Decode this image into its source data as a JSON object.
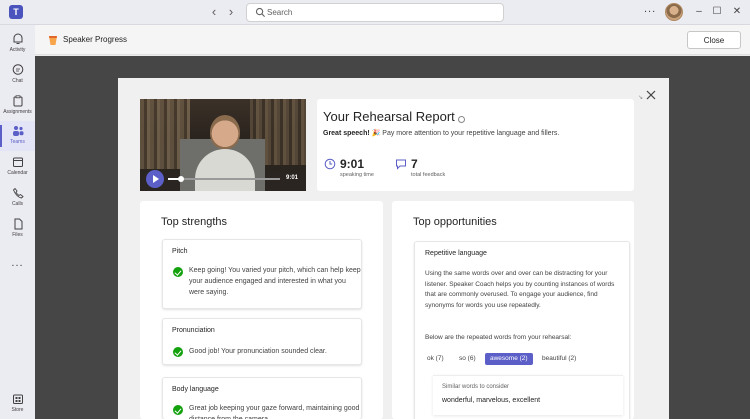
{
  "titlebar": {
    "app_logo": "T",
    "back_icon": "chevron-left",
    "forward_icon": "chevron-right",
    "search_placeholder": "Search",
    "more": "...",
    "minimize": "–",
    "maximize": "☐",
    "close": "✕"
  },
  "rail": {
    "items": [
      {
        "label": "Activity",
        "icon": "bell-icon"
      },
      {
        "label": "Chat",
        "icon": "chat-icon"
      },
      {
        "label": "Assignments",
        "icon": "assignments-icon"
      },
      {
        "label": "Teams",
        "icon": "teams-icon",
        "active": true
      },
      {
        "label": "Calendar",
        "icon": "calendar-icon"
      },
      {
        "label": "Calls",
        "icon": "phone-icon"
      },
      {
        "label": "Files",
        "icon": "file-icon"
      }
    ],
    "more": "...",
    "store_label": "Store"
  },
  "appbar": {
    "title": "Speaker Progress",
    "close_label": "Close"
  },
  "video": {
    "duration": "9:01",
    "progress": 0.12
  },
  "report": {
    "title": "Your Rehearsal Report",
    "sub_bold": "Great speech! 🎉",
    "sub_rest": " Pay more attention to your repetitive language and fillers.",
    "speaking_time_value": "9:01",
    "speaking_time_label": "speaking time",
    "feedback_value": "7",
    "feedback_label": "total feedback"
  },
  "strengths": {
    "title": "Top strengths",
    "cards": [
      {
        "head": "Pitch",
        "text": "Keep going! You varied your pitch, which can help keep your audience engaged and interested in what you were saying."
      },
      {
        "head": "Pronunciation",
        "text": "Good job! Your pronunciation sounded clear."
      },
      {
        "head": "Body language",
        "text": "Great job keeping your gaze forward, maintaining good distance from the camera"
      }
    ]
  },
  "opportunities": {
    "title": "Top opportunities",
    "head": "Repetitive language",
    "paragraph": "Using the same words over and over can be distracting for your listener. Speaker Coach helps you by counting instances of words that are commonly overused. To engage your audience, find synonyms for words you use repeatedly.",
    "list_head": "Below are the repeated words from your rehearsal:",
    "chips": [
      "ok (7)",
      "so (6)",
      "awesome (2)",
      "beautiful (2)"
    ],
    "selected_chip": "awesome (2)",
    "similar_label": "Similar words to consider",
    "similar_words": "wonderful, marvelous, excellent"
  },
  "colors": {
    "accent": "#5b5fc7",
    "success": "#13a10e",
    "backdrop": "#464646"
  }
}
